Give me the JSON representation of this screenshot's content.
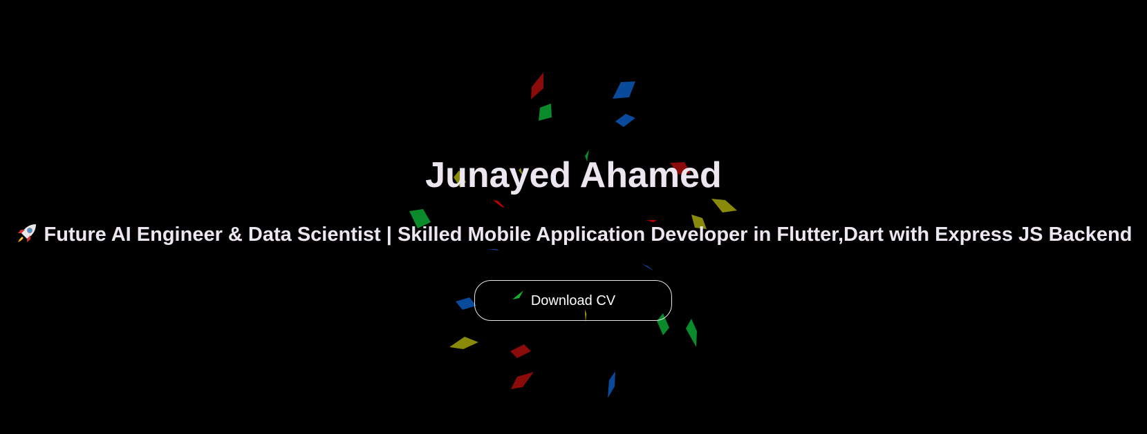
{
  "hero": {
    "name": "Junayed Ahamed",
    "tagline": "Future AI Engineer & Data Scientist | Skilled Mobile Application Developer in Flutter,Dart with Express JS Backend",
    "tagline_icon": "rocket-icon",
    "cta_label": "Download CV"
  },
  "theme": {
    "background": "#000000",
    "text": "#ECE6F0",
    "button_border": "#ECE6F0"
  },
  "confetti": {
    "colors": [
      "#8B0A0A",
      "#0A4A9B",
      "#0A8A2A",
      "#8A8A0A",
      "#C00000"
    ]
  }
}
